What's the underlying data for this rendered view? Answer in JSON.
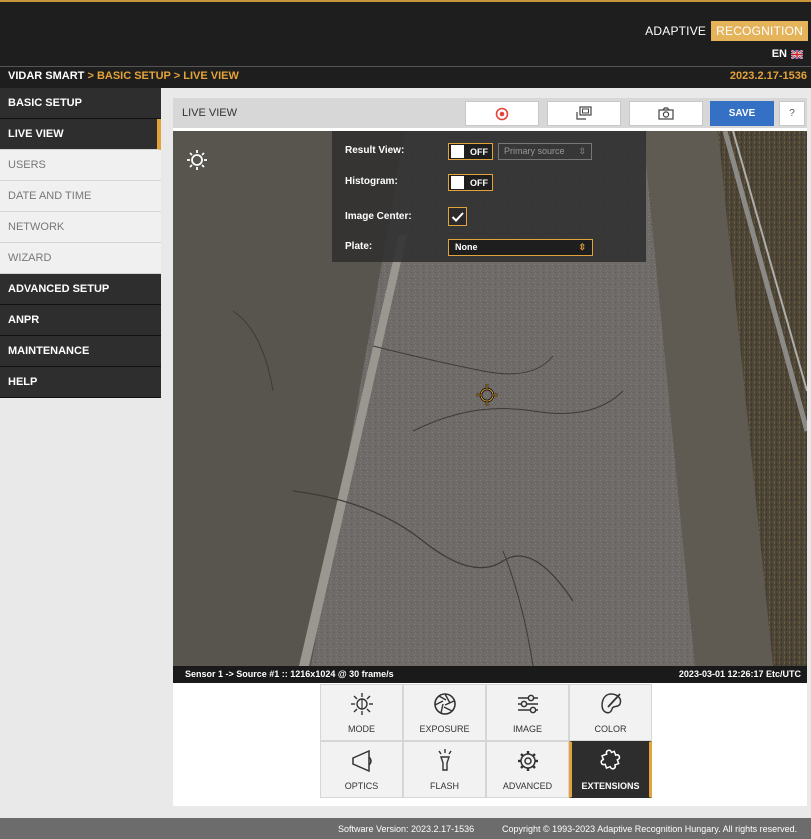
{
  "header": {
    "brand_left": "ADAPTIVE",
    "brand_right": "RECOGNITION",
    "language": "EN",
    "breadcrumb": {
      "product": "VIDAR SMART",
      "sep1": " > ",
      "section": "BASIC SETUP",
      "sep2": " > ",
      "page": "LIVE VIEW"
    },
    "version": "2023.2.17-1536"
  },
  "sidebar": {
    "items": [
      {
        "label": "BASIC SETUP"
      },
      {
        "label": "LIVE VIEW"
      },
      {
        "label": "USERS"
      },
      {
        "label": "DATE AND TIME"
      },
      {
        "label": "NETWORK"
      },
      {
        "label": "WIZARD"
      },
      {
        "label": "ADVANCED SETUP"
      },
      {
        "label": "ANPR"
      },
      {
        "label": "MAINTENANCE"
      },
      {
        "label": "HELP"
      }
    ]
  },
  "toolbar": {
    "title": "LIVE VIEW",
    "save_label": "SAVE",
    "help_label": "?"
  },
  "overlay": {
    "result_view_label": "Result View:",
    "result_view_state": "OFF",
    "source_select": "Primary source",
    "histogram_label": "Histogram:",
    "histogram_state": "OFF",
    "image_center_label": "Image Center:",
    "image_center_checked": true,
    "plate_label": "Plate:",
    "plate_value": "None"
  },
  "status": {
    "left": "Sensor 1 -> Source #1 :: 1216x1024 @ 30 frame/s",
    "right": "2023-03-01 12:26:17 Etc/UTC"
  },
  "controls": [
    {
      "label": "MODE",
      "icon": "sun-icon"
    },
    {
      "label": "EXPOSURE",
      "icon": "aperture-icon"
    },
    {
      "label": "IMAGE",
      "icon": "sliders-icon"
    },
    {
      "label": "COLOR",
      "icon": "palette-icon"
    },
    {
      "label": "OPTICS",
      "icon": "lens-icon"
    },
    {
      "label": "FLASH",
      "icon": "flash-icon"
    },
    {
      "label": "ADVANCED",
      "icon": "gear-icon"
    },
    {
      "label": "EXTENSIONS",
      "icon": "puzzle-icon",
      "active": true
    }
  ],
  "footer": {
    "version_text": "Software Version:  2023.2.17-1536",
    "copyright": "Copyright © 1993-2023 Adaptive Recognition Hungary. All rights reserved."
  },
  "colors": {
    "accent": "#e4a33a",
    "save_button": "#3471c4",
    "header_bg": "#1e1e1e"
  }
}
